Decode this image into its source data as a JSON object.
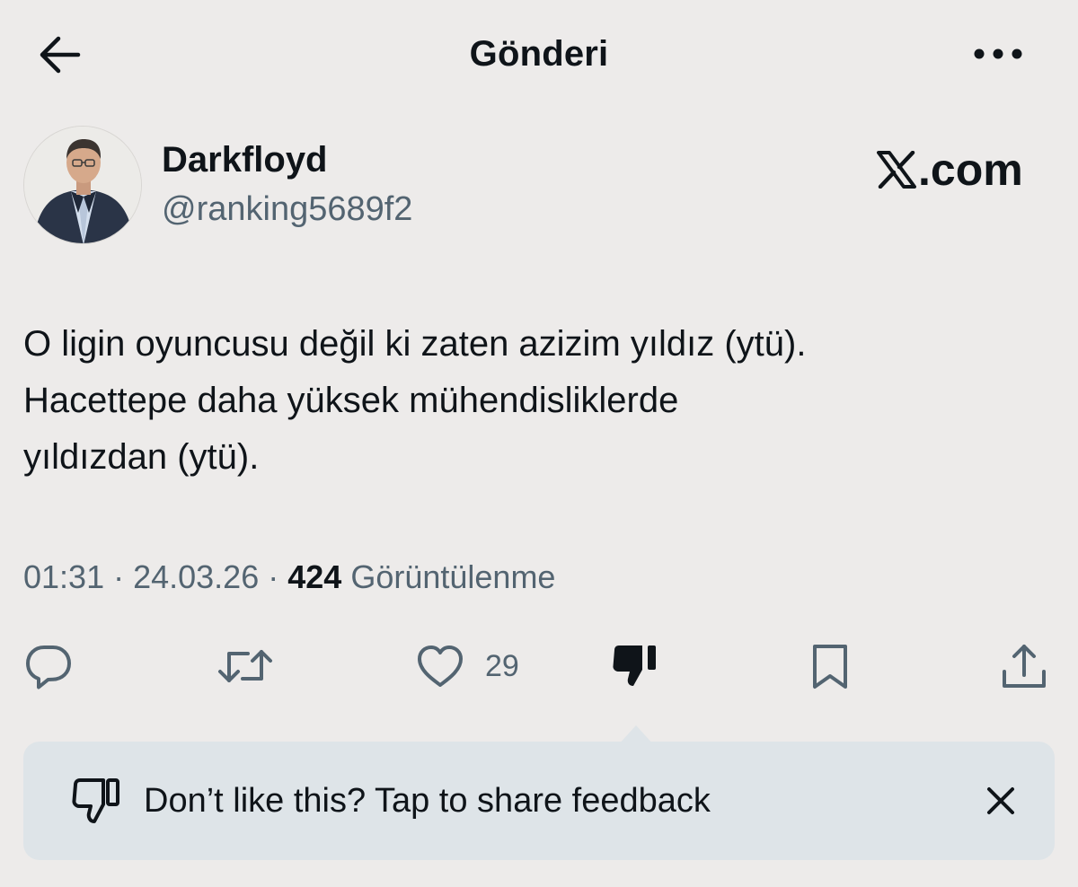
{
  "header": {
    "title": "Gönderi",
    "back_icon": "arrow-left-icon",
    "more_icon": "more-horizontal-icon"
  },
  "author": {
    "display_name": "Darkfloyd",
    "handle": "@ranking5689f2"
  },
  "brand": {
    "text": ".com",
    "icon": "x-logo-icon"
  },
  "tweet": {
    "text": "O ligin oyuncusu değil ki zaten azizim yıldız (ytü).\nHacettepe daha yüksek mühendisliklerde\nyıldızdan (ytü).",
    "time": "01:31",
    "date": "24.03.26",
    "separator": " · ",
    "views_count": "424",
    "views_label": "Görüntülenme"
  },
  "actions": {
    "reply_icon": "reply-icon",
    "repost_icon": "repost-icon",
    "like_icon": "heart-icon",
    "like_count": "29",
    "dislike_icon": "thumbs-down-icon",
    "bookmark_icon": "bookmark-icon",
    "share_icon": "share-icon"
  },
  "feedback": {
    "text": "Don’t like this? Tap to share feedback",
    "icon": "thumbs-down-outline-icon",
    "close_icon": "close-icon"
  },
  "colors": {
    "background": "#edebea",
    "text_primary": "#0f1419",
    "text_secondary": "#536471",
    "feedback_bg": "#dee4e8"
  }
}
